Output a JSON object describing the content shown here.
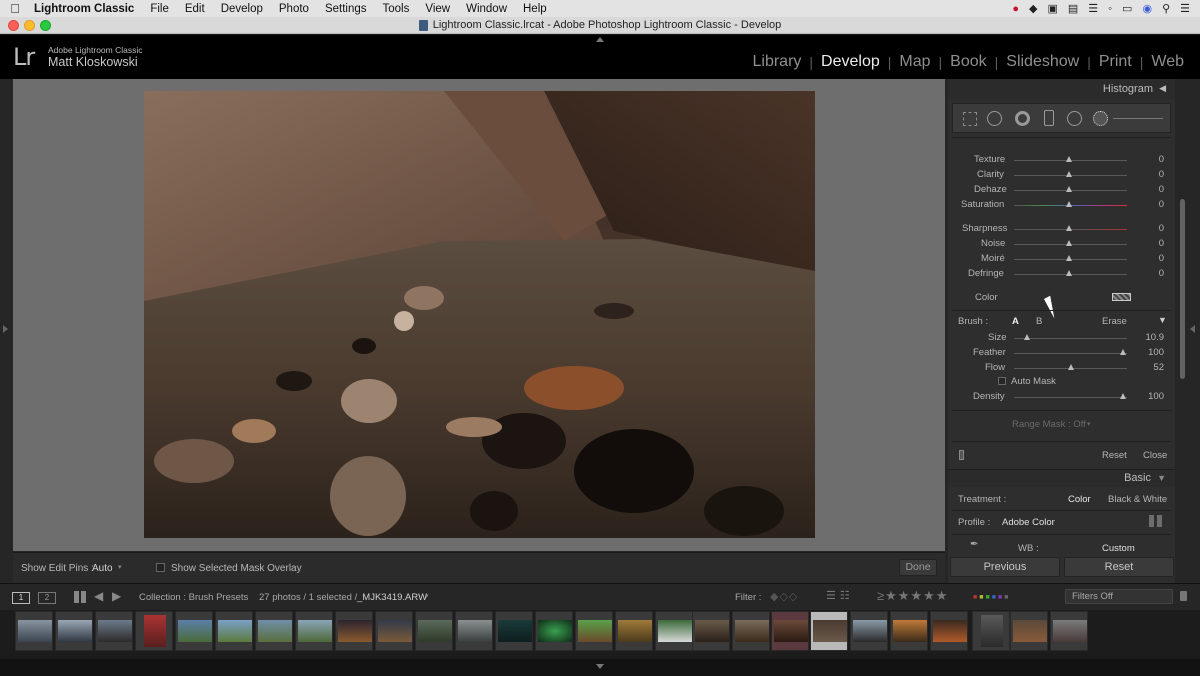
{
  "menubar": {
    "app": "Lightroom Classic",
    "items": [
      "File",
      "Edit",
      "Develop",
      "Photo",
      "Settings",
      "Tools",
      "View",
      "Window",
      "Help"
    ]
  },
  "window": {
    "title": "Lightroom Classic.lrcat - Adobe Photoshop Lightroom Classic - Develop"
  },
  "identity": {
    "logo": "Lr",
    "app_name": "Adobe Lightroom Classic",
    "user": "Matt Kloskowski"
  },
  "modules": {
    "library": "Library",
    "develop": "Develop",
    "map": "Map",
    "book": "Book",
    "slideshow": "Slideshow",
    "print": "Print",
    "web": "Web",
    "active": "Develop"
  },
  "panel": {
    "histogram_title": "Histogram",
    "sliders": [
      {
        "label": "Texture",
        "value": "0"
      },
      {
        "label": "Clarity",
        "value": "0"
      },
      {
        "label": "Dehaze",
        "value": "0"
      },
      {
        "label": "Saturation",
        "value": "0"
      },
      {
        "label": "Sharpness",
        "value": "0"
      },
      {
        "label": "Noise",
        "value": "0"
      },
      {
        "label": "Moiré",
        "value": "0"
      },
      {
        "label": "Defringe",
        "value": "0"
      }
    ],
    "color_label": "Color",
    "brush": {
      "label": "Brush :",
      "a": "A",
      "b": "B",
      "erase": "Erase",
      "size_label": "Size",
      "size_value": "10.9",
      "feather_label": "Feather",
      "feather_value": "100",
      "flow_label": "Flow",
      "flow_value": "52",
      "auto_mask": "Auto Mask",
      "density_label": "Density",
      "density_value": "100"
    },
    "range_mask": "Range Mask : Off",
    "reset": "Reset",
    "close": "Close",
    "basic_title": "Basic",
    "treatment_label": "Treatment :",
    "treatment_color": "Color",
    "treatment_bw": "Black & White",
    "profile_label": "Profile :",
    "profile_value": "Adobe Color",
    "wb_label": "WB :",
    "wb_value": "Custom",
    "previous": "Previous",
    "reset_button": "Reset"
  },
  "toolbar": {
    "show_edit_pins": "Show Edit Pins :",
    "pins_value": "Auto",
    "mask_overlay": "Show Selected Mask Overlay",
    "done": "Done"
  },
  "filmbar": {
    "page1": "1",
    "page2": "2",
    "collection": "Collection : Brush Presets",
    "count": "27 photos / 1 selected /",
    "filename": "_MJK3419.ARW",
    "filter_label": "Filter :",
    "filters_off": "Filters Off"
  },
  "colors": {
    "accent_label": "#cccccc",
    "panel_bg": "#2e2e2e",
    "canvas_bg": "#6e6e6e"
  }
}
